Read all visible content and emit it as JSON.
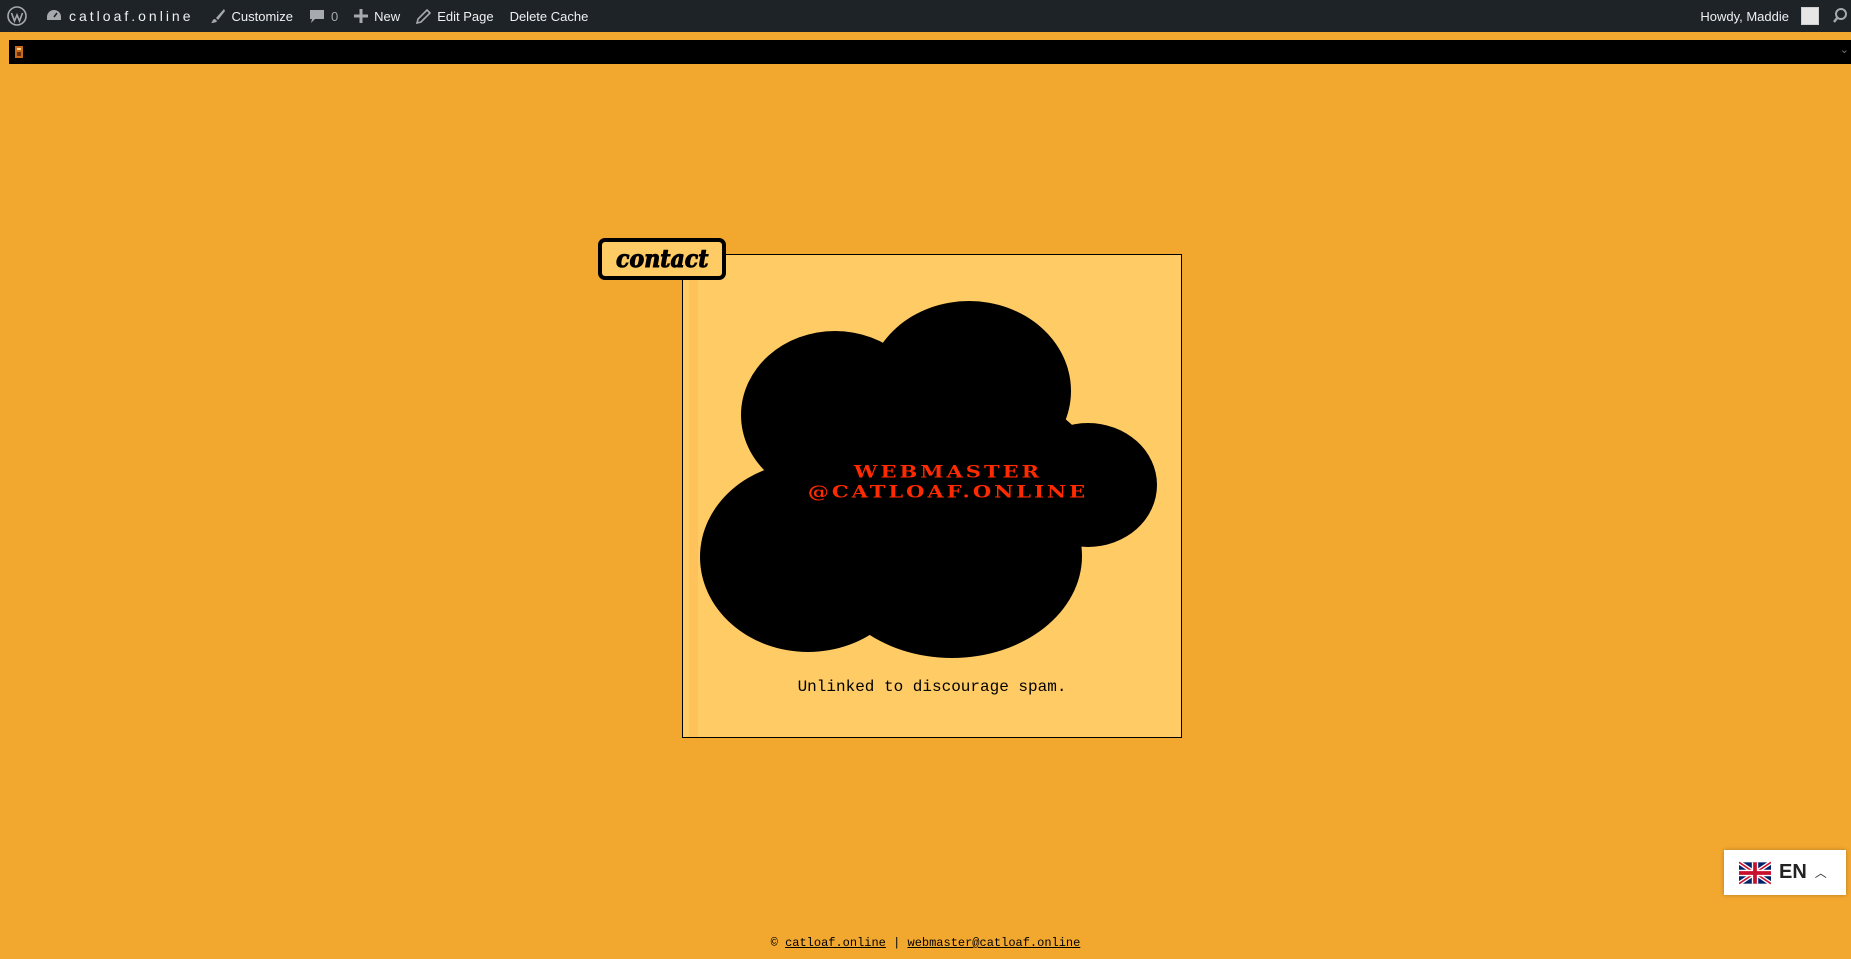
{
  "adminbar": {
    "site_name": "catloaf.online",
    "customize": "Customize",
    "comments_count": "0",
    "new_label": "New",
    "edit_page": "Edit Page",
    "delete_cache": "Delete Cache",
    "howdy": "Howdy, Maddie",
    "icons": [
      "wordpress-icon",
      "dashboard-icon",
      "brush-icon",
      "comment-icon",
      "plus-icon",
      "pencil-icon",
      "search-icon"
    ]
  },
  "main": {
    "tab_text": "contact",
    "email_line1": "WEBMASTER",
    "email_line2": "@CATLOAF.ONLINE",
    "caption": "Unlinked to discourage spam."
  },
  "footer": {
    "copyright": "©",
    "site_link": "catloaf.online",
    "separator": "|",
    "email_link": "webmaster@catloaf.online"
  },
  "language": {
    "code": "EN",
    "flag": "uk-flag-icon"
  },
  "colors": {
    "page_bg": "#F2A72F",
    "card_bg": "#FFCB65",
    "adminbar_bg": "#1D2327",
    "email_text": "#FF2A00"
  }
}
